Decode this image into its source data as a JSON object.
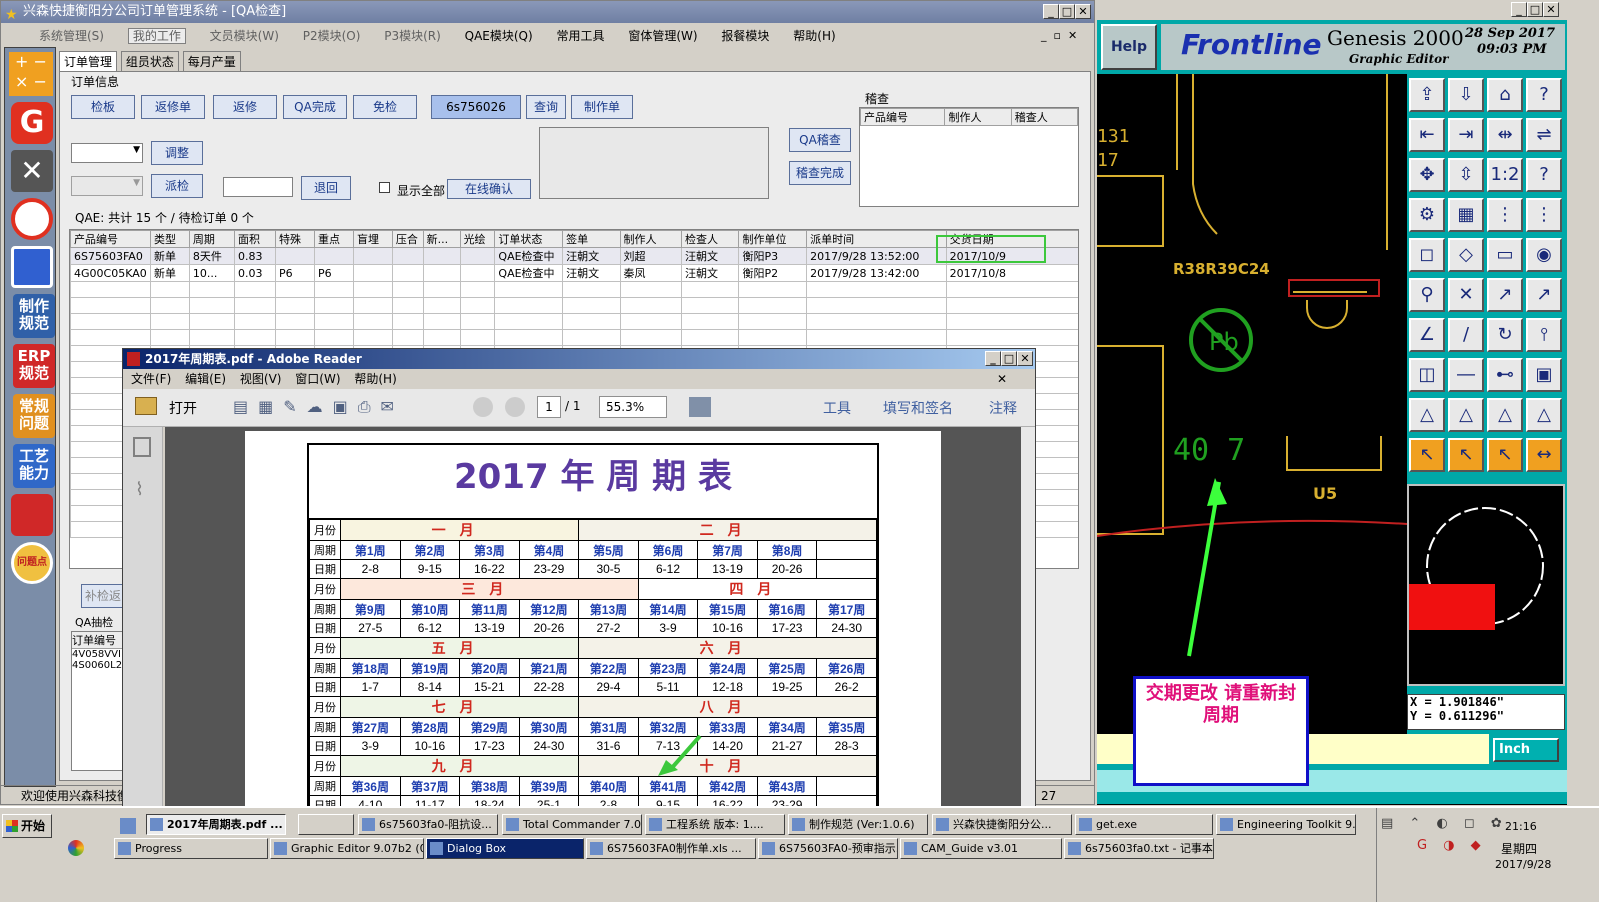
{
  "main_window": {
    "title": "兴森快捷衡阳分公司订单管理系统 - [QA检查]",
    "menu": [
      "系统管理(S)",
      "我的工作",
      "文员模块(W)",
      "P2模块(O)",
      "P3模块(R)",
      "QAE模块(Q)",
      "常用工具",
      "窗体管理(W)",
      "报餐模块",
      "帮助(H)"
    ],
    "tabs": [
      "订单管理",
      "组员状态",
      "每月产量"
    ],
    "group_label": "订单信息",
    "buttons": {
      "jianban": "检板",
      "fanxiudan": "返修单",
      "fanxiu": "返修",
      "qa_done": "QA完成",
      "mianjian": "免检",
      "query": "查询",
      "make_order": "制作单",
      "adjust": "调整",
      "dispatch": "派检",
      "return": "退回",
      "online_confirm": "在线确认",
      "qa_audit": "QA稽查",
      "audit_done": "稽查完成",
      "rework": "补检返"
    },
    "order_input": "6s756026",
    "show_all": "显示全部",
    "audit": {
      "label": "稽查",
      "cols": [
        "产品编号",
        "制作人",
        "稽查人"
      ]
    },
    "summary": "QAE: 共计 15 个 / 待检订单 0 个",
    "table": {
      "cols": [
        "产品编号",
        "类型",
        "周期",
        "面积",
        "特殊",
        "重点",
        "盲埋",
        "压合",
        "新...",
        "光绘",
        "订单状态",
        "签单",
        "制作人",
        "检查人",
        "制作单位",
        "派单时间",
        "交货日期"
      ],
      "rows": [
        [
          "6S75603FA0",
          "新单",
          "8天件",
          "0.83",
          "",
          "",
          "",
          "",
          "",
          "",
          "QAE检查中",
          "汪朝文",
          "刘超",
          "汪朝文",
          "衡阳P3",
          "2017/9/28 13:52:00",
          "2017/10/9"
        ],
        [
          "4G00C05KA0",
          "新单",
          "10...",
          "0.03",
          "P6",
          "P6",
          "",
          "",
          "",
          "",
          "QAE检查中",
          "汪朝文",
          "秦凤",
          "汪朝文",
          "衡阳P2",
          "2017/9/28 13:42:00",
          "2017/10/8"
        ]
      ]
    },
    "qa_sample": {
      "label": "QA抽检",
      "col": "订单编号",
      "rows": [
        "4V058VVI",
        "4S0060L2"
      ]
    },
    "status": "欢迎使用兴森科技衡",
    "status_right": "27"
  },
  "sidebar": [
    "制作规范",
    "ERP规范",
    "常规问题",
    "工艺能力",
    "问题点"
  ],
  "reader": {
    "title": "2017年周期表.pdf - Adobe Reader",
    "menu": [
      "文件(F)",
      "编辑(E)",
      "视图(V)",
      "窗口(W)",
      "帮助(H)"
    ],
    "open": "打开",
    "page": "1",
    "pages": "/ 1",
    "zoom": "55.3%",
    "tools": "工具",
    "sign": "填写和签名",
    "comment": "注释",
    "doc_title": "2017 年 周 期 表",
    "labels": {
      "month": "月份",
      "week": "周期",
      "date": "日期"
    },
    "blocks": [
      {
        "months": [
          "一月",
          "二月"
        ],
        "split": 4,
        "weeks": [
          "第1周",
          "第2周",
          "第3周",
          "第4周",
          "第5周",
          "第6周",
          "第7周",
          "第8周",
          ""
        ],
        "dates": [
          "2-8",
          "9-15",
          "16-22",
          "23-29",
          "30-5",
          "6-12",
          "13-19",
          "20-26",
          ""
        ]
      },
      {
        "months": [
          "三月",
          "四月"
        ],
        "split": 5,
        "weeks": [
          "第9周",
          "第10周",
          "第11周",
          "第12周",
          "第13周",
          "第14周",
          "第15周",
          "第16周",
          "第17周"
        ],
        "dates": [
          "27-5",
          "6-12",
          "13-19",
          "20-26",
          "27-2",
          "3-9",
          "10-16",
          "17-23",
          "24-30"
        ]
      },
      {
        "months": [
          "五月",
          "六月"
        ],
        "split": 4,
        "weeks": [
          "第18周",
          "第19周",
          "第20周",
          "第21周",
          "第22周",
          "第23周",
          "第24周",
          "第25周",
          "第26周"
        ],
        "dates": [
          "1-7",
          "8-14",
          "15-21",
          "22-28",
          "29-4",
          "5-11",
          "12-18",
          "19-25",
          "26-2"
        ]
      },
      {
        "months": [
          "七月",
          "八月"
        ],
        "split": 4,
        "weeks": [
          "第27周",
          "第28周",
          "第29周",
          "第30周",
          "第31周",
          "第32周",
          "第33周",
          "第34周",
          "第35周"
        ],
        "dates": [
          "3-9",
          "10-16",
          "17-23",
          "24-30",
          "31-6",
          "7-13",
          "14-20",
          "21-27",
          "28-3"
        ]
      },
      {
        "months": [
          "九月",
          "十月"
        ],
        "split": 4,
        "weeks": [
          "第36周",
          "第37周",
          "第38周",
          "第39周",
          "第40周",
          "第41周",
          "第42周",
          "第43周",
          ""
        ],
        "dates": [
          "4-10",
          "11-17",
          "18-24",
          "25-1",
          "2-8",
          "9-15",
          "16-22",
          "23-29",
          ""
        ]
      }
    ]
  },
  "genesis": {
    "help": "Help",
    "brand": "Frontline",
    "product": "Genesis 2000",
    "sub": "Graphic Editor",
    "date": "28 Sep 2017",
    "time": "09:03 PM",
    "labels": {
      "a": "131",
      "b": "17",
      "c": "R38R39C24",
      "d": "U5"
    },
    "x": "X = 1.901846\"",
    "y": "Y = 0.611296\"",
    "unit": "Inch"
  },
  "annotation": "交期更改 请重新封周期",
  "taskbar": {
    "start": "开始",
    "row1": [
      "2017年周期表.pdf ...",
      "6s75603fa0-阻抗设...",
      "Total Commander 7.0...",
      "工程系统  版本: 1....",
      "制作规范 (Ver:1.0.6)",
      "兴森快捷衡阳分公...",
      "get.exe",
      "Engineering Toolkit 9...."
    ],
    "row2": [
      "Progress",
      "Graphic Editor 9.07b2 (0...",
      "Dialog Box",
      "6S75603FA0制作单.xls ...",
      "6S75603FA0-预审指示....",
      "CAM_Guide v3.01",
      "6s75603fa0.txt - 记事本"
    ],
    "time": "21:16",
    "weekday": "星期四",
    "date": "2017/9/28"
  },
  "colors": {
    "highlight": "#3cc83c",
    "annotation_border": "#1010c8",
    "annotation_text": "#e0107a"
  }
}
